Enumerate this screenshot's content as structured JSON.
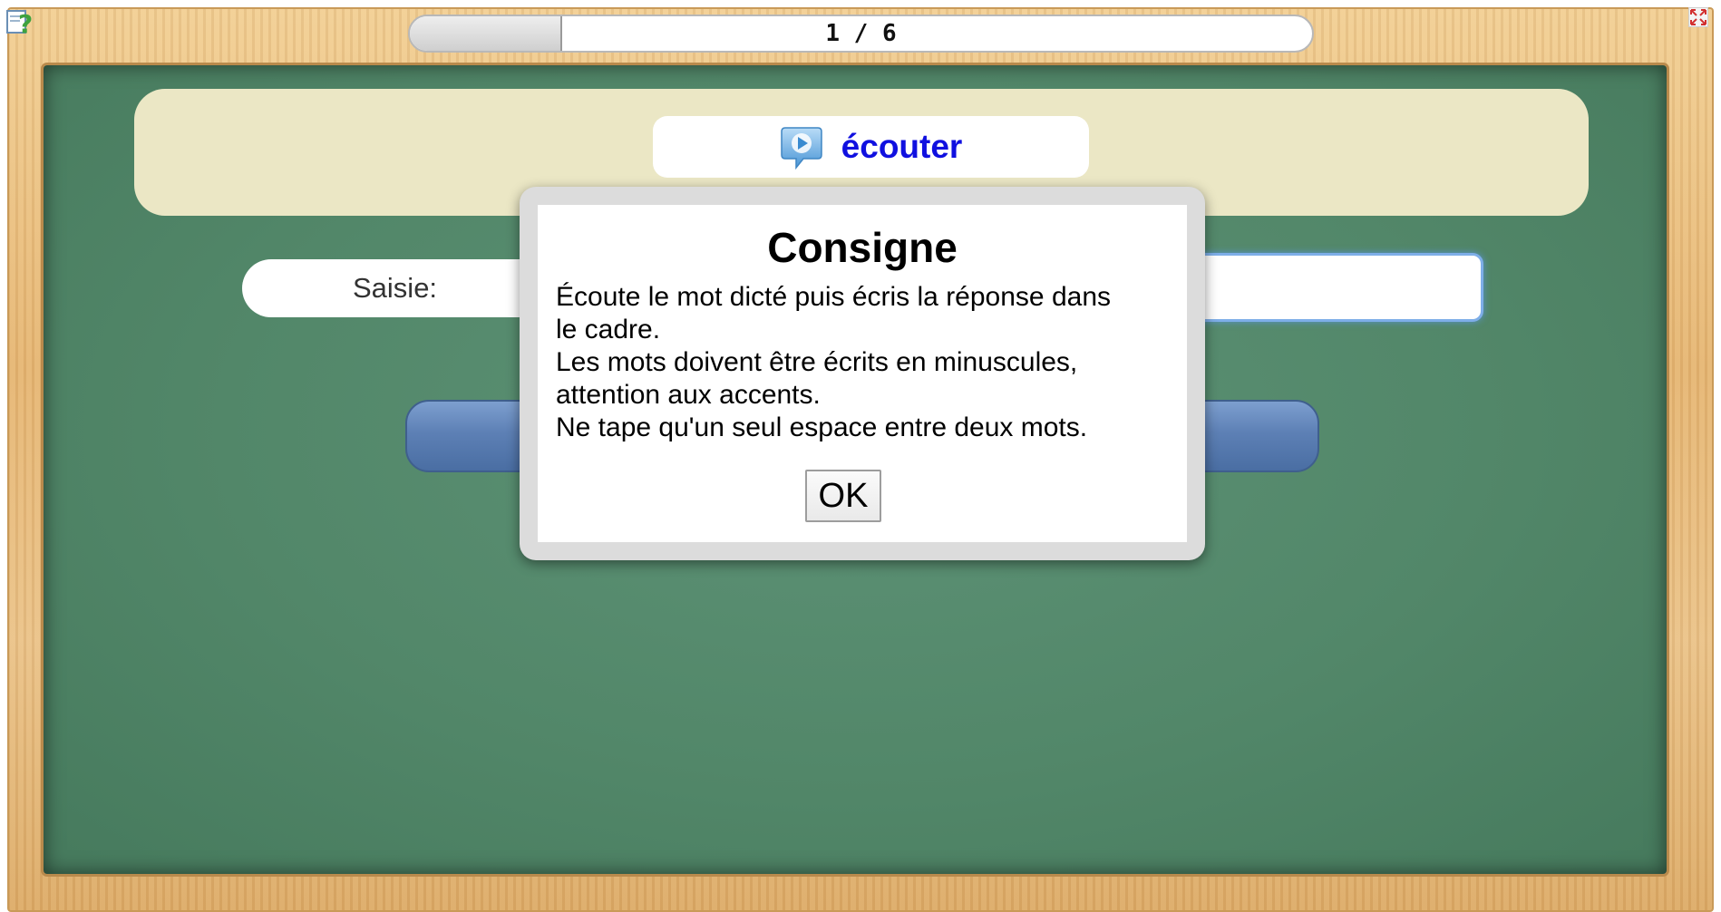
{
  "progress": {
    "text": "1 / 6",
    "current": 1,
    "total": 6
  },
  "icons": {
    "help": "help-question-icon",
    "fullscreen": "fullscreen-icon",
    "speaker": "speaker-play-icon"
  },
  "listen": {
    "label": "écouter"
  },
  "answer": {
    "label": "Saisie:",
    "value": ""
  },
  "modal": {
    "title": "Consigne",
    "lines": [
      "Écoute le mot dicté puis écris la réponse dans",
      "le cadre.",
      "Les mots doivent être écrits en minuscules,",
      "attention aux accents.",
      "Ne tape qu'un seul espace entre deux mots."
    ],
    "ok_label": "OK"
  },
  "colors": {
    "board": "#528769",
    "frame": "#e5b572",
    "panel": "#ebe7c5",
    "listen_text": "#1010e0",
    "validate_button": "#5d80b5"
  }
}
